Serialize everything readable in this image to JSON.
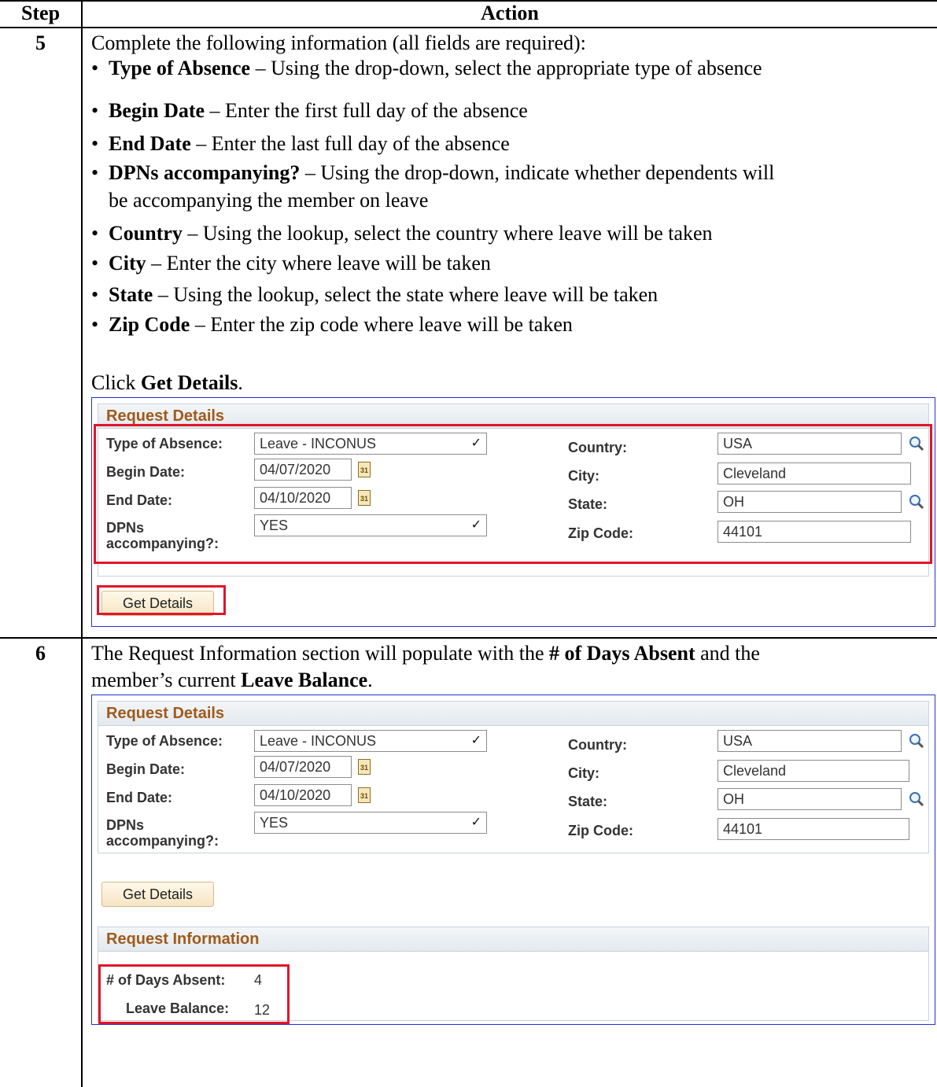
{
  "table": {
    "step_header": "Step",
    "action_header": "Action"
  },
  "step5": {
    "num": "5",
    "intro": "Complete the following information (all fields are required):",
    "bullets": [
      {
        "term": "Type of Absence",
        "desc": " – Using the drop-down, select the appropriate type of absence"
      },
      {
        "term": "Begin Date",
        "desc": " – Enter the first full day of the absence"
      },
      {
        "term": "End Date",
        "desc": " – Enter the last full day of the absence"
      },
      {
        "term": "DPNs accompanying?",
        "desc": " – Using the drop-down, indicate whether dependents will"
      },
      {
        "term": "Country",
        "desc": " – Using the lookup, select the country where leave will be taken"
      },
      {
        "term": "City",
        "desc": " – Enter the city where leave will be taken"
      },
      {
        "term": "State",
        "desc": " – Using the lookup, select the state where leave will be taken"
      },
      {
        "term": "Zip Code",
        "desc": " – Enter the zip code where leave will be taken"
      }
    ],
    "bullet3_cont": "be accompanying the member on leave",
    "click_prefix": "Click ",
    "click_term": "Get Details",
    "click_suffix": "."
  },
  "step6": {
    "num": "6",
    "line1_prefix": "The Request Information section will populate with the ",
    "line1_term": "# of Days Absent",
    "line1_suffix": " and the",
    "line2_prefix": "member’s current ",
    "line2_term": "Leave Balance",
    "line2_suffix": "."
  },
  "form": {
    "section_title": "Request Details",
    "type_label": "Type of Absence:",
    "type_value": "Leave - INCONUS",
    "begin_label": "Begin Date:",
    "begin_value": "04/07/2020",
    "end_label": "End Date:",
    "end_value": "04/10/2020",
    "dpn_label_1": "DPNs",
    "dpn_label_2": "accompanying?:",
    "dpn_value": "YES",
    "country_label": "Country:",
    "country_value": "USA",
    "city_label": "City:",
    "city_value": "Cleveland",
    "state_label": "State:",
    "state_value": "OH",
    "zip_label": "Zip Code:",
    "zip_value": "44101",
    "button_label": "Get Details",
    "cal_glyph": "31"
  },
  "info": {
    "section_title": "Request Information",
    "days_label": "# of Days Absent:",
    "days_value": "4",
    "balance_label": "Leave Balance:",
    "balance_value": "12"
  },
  "colors": {
    "highlight": "#e0162b",
    "section_title": "#a05a1a",
    "panel_border": "#2233cc"
  }
}
